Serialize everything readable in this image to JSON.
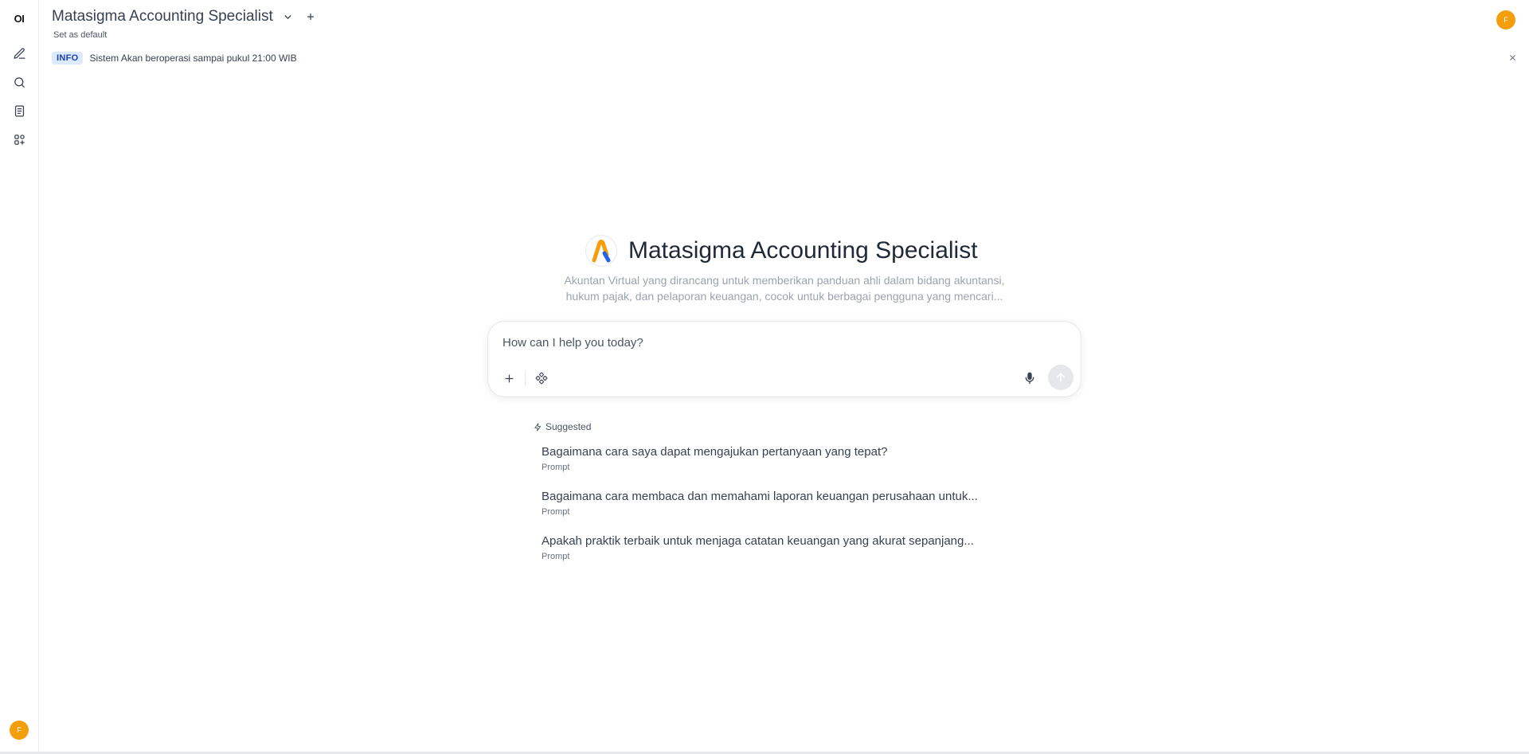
{
  "rail": {
    "logo": "OI",
    "avatar_initial": "F"
  },
  "header": {
    "model_name": "Matasigma Accounting Specialist",
    "set_default": "Set as default",
    "avatar_initial": "F"
  },
  "banner": {
    "badge": "INFO",
    "text": "Sistem Akan beroperasi sampai pukul 21:00 WIB",
    "close": "×"
  },
  "hero": {
    "title": "Matasigma Accounting Specialist",
    "description": "Akuntan Virtual yang dirancang untuk memberikan panduan ahli dalam bidang akuntansi, hukum pajak, dan pelaporan keuangan, cocok untuk berbagai pengguna yang mencari..."
  },
  "input": {
    "placeholder": "How can I help you today?",
    "value": ""
  },
  "suggestions": {
    "heading": "Suggested",
    "items": [
      {
        "title": "Bagaimana cara saya dapat mengajukan pertanyaan yang tepat?",
        "sub": "Prompt"
      },
      {
        "title": "Bagaimana cara membaca dan memahami laporan keuangan perusahaan untuk...",
        "sub": "Prompt"
      },
      {
        "title": "Apakah praktik terbaik untuk menjaga catatan keuangan yang akurat sepanjang...",
        "sub": "Prompt"
      }
    ]
  },
  "colors": {
    "avatar": "#f59e0b",
    "info_badge_bg": "#dbeafe",
    "info_badge_text": "#1e40af",
    "logo_orange": "#f59e0b",
    "logo_blue": "#2563eb"
  },
  "icons": [
    "new-chat-icon",
    "search-icon",
    "notes-icon",
    "workspace-icon",
    "chevron-down-icon",
    "plus-icon",
    "close-icon",
    "tools-icon",
    "mic-icon",
    "arrow-up-icon",
    "sparkle-icon"
  ]
}
